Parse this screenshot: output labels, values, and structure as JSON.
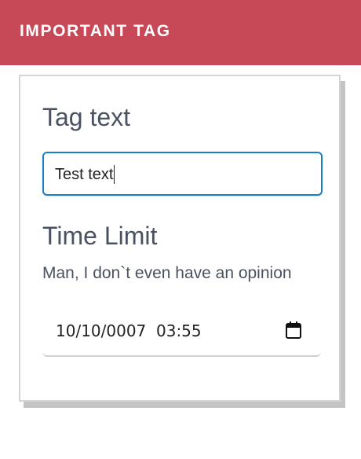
{
  "header": {
    "title": "IMPORTANT TAG",
    "background_color": "#c74856"
  },
  "form": {
    "tag_label": "Tag text",
    "tag_value": "Test text",
    "tag_input_focus_color": "#1a7fc4",
    "time_label": "Time Limit",
    "time_description": "Man, I don`t even have an opinion",
    "datetime_value": "10/10/0007  03:55",
    "calendar_icon": "calendar-icon"
  }
}
